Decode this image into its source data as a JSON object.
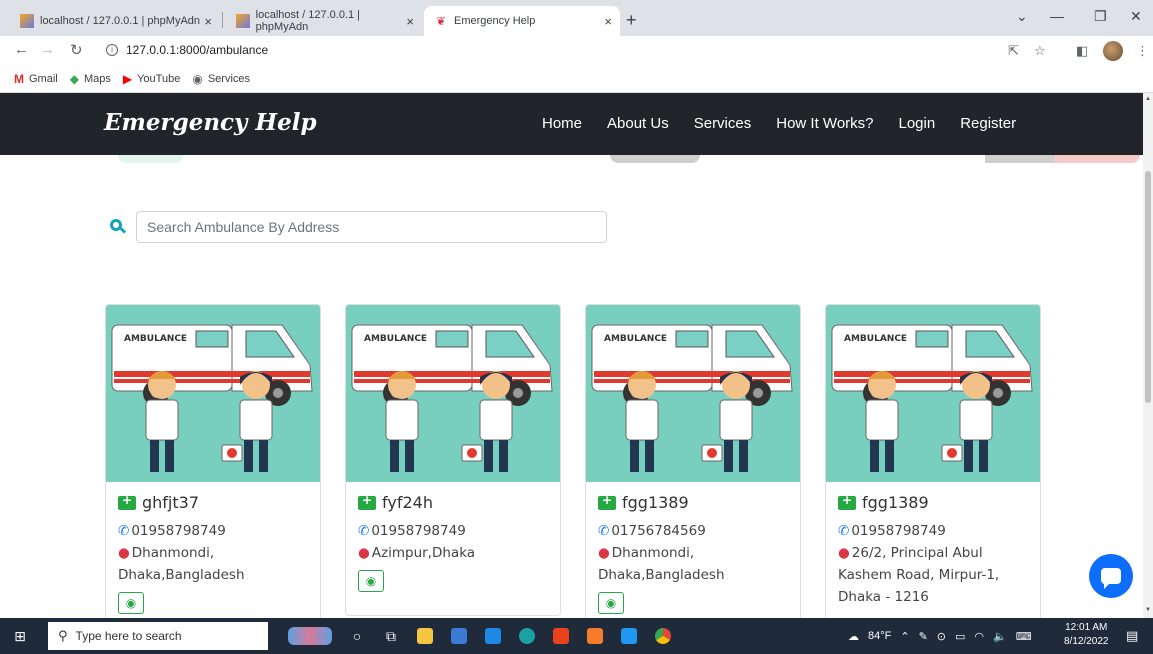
{
  "browser": {
    "tabs": [
      {
        "title": "localhost / 127.0.0.1 | phpMyAdn"
      },
      {
        "title": "localhost / 127.0.0.1 | phpMyAdn"
      },
      {
        "title": "Emergency Help"
      }
    ],
    "address": "127.0.0.1:8000/ambulance",
    "bookmarks": [
      {
        "label": "Gmail"
      },
      {
        "label": "Maps"
      },
      {
        "label": "YouTube"
      },
      {
        "label": "Services"
      }
    ]
  },
  "site": {
    "brand": "Emergency Help",
    "menu": [
      "Home",
      "About Us",
      "Services",
      "How It Works?",
      "Login",
      "Register"
    ]
  },
  "search": {
    "placeholder": "Search Ambulance By Address"
  },
  "cards": [
    {
      "name": "ghfjt37",
      "phone": "01958798749",
      "address_lines": [
        "Dhanmondi,",
        "Dhaka,Bangladesh"
      ]
    },
    {
      "name": "fyf24h",
      "phone": "01958798749",
      "address_lines": [
        "Azimpur,Dhaka"
      ]
    },
    {
      "name": "fgg1389",
      "phone": "01756784569",
      "address_lines": [
        "Dhanmondi,",
        "Dhaka,Bangladesh"
      ]
    },
    {
      "name": "fgg1389",
      "phone": "01958798749",
      "address_lines": [
        "26/2, Principal Abul",
        "Kashem Road, Mirpur-1,",
        "Dhaka - 1216"
      ]
    }
  ],
  "ambulance_label": "AMBULANCE",
  "taskbar": {
    "search_placeholder": "Type here to search",
    "weather": "84°F",
    "time": "12:01 AM",
    "date": "8/12/2022"
  },
  "colors": {
    "navbar": "#212529",
    "card_image_bg": "#78cfc0",
    "accent_teal": "#17a2b8",
    "chat_button": "#0d6efd",
    "view_button": "#28a745"
  }
}
